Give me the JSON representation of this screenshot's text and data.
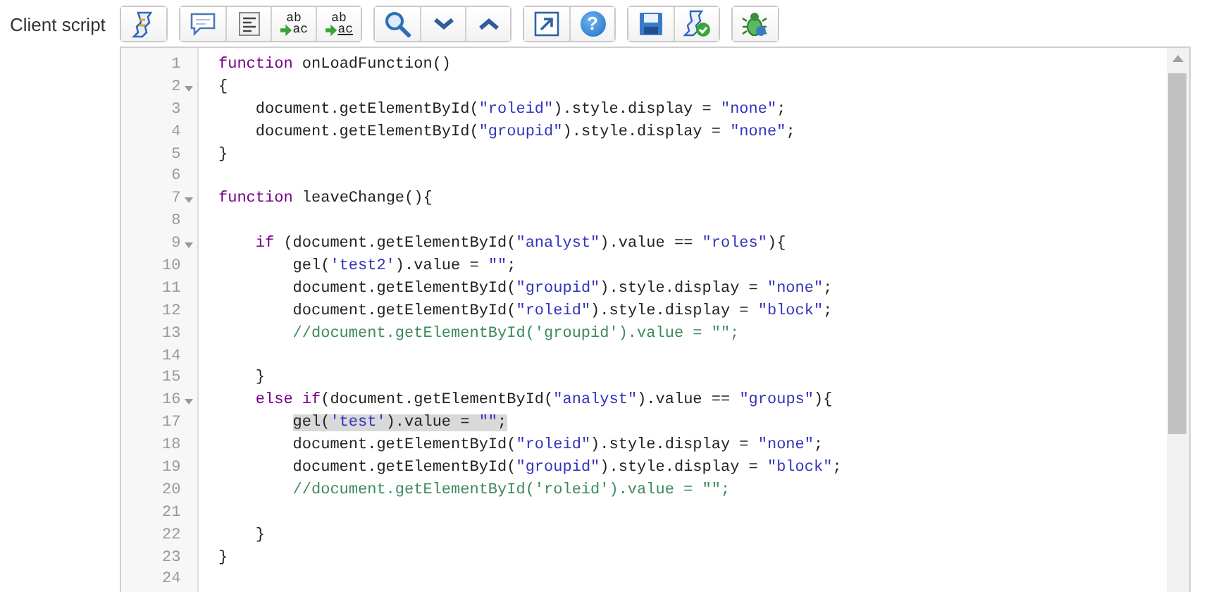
{
  "field_label": "Client script",
  "toolbar": [
    [
      {
        "kind": "script"
      }
    ],
    [
      {
        "kind": "comment"
      },
      {
        "kind": "format"
      },
      {
        "kind": "replace",
        "icon_text": [
          "ab",
          "ac"
        ]
      },
      {
        "kind": "replace_all",
        "icon_text": [
          "ab",
          "ac"
        ]
      }
    ],
    [
      {
        "kind": "search"
      },
      {
        "kind": "next"
      },
      {
        "kind": "previous"
      }
    ],
    [
      {
        "kind": "fullscreen"
      },
      {
        "kind": "help",
        "icon_text": [
          "?"
        ]
      }
    ],
    [
      {
        "kind": "save"
      },
      {
        "kind": "validate"
      }
    ],
    [
      {
        "kind": "debug"
      }
    ]
  ],
  "editor": {
    "lines": [
      {
        "number": "1",
        "fold": false,
        "selected": false,
        "kind": "flush",
        "tokens": [
          {
            "kind": "keyword",
            "text": "function"
          },
          {
            "kind": "plain",
            "text": " onLoadFunction()"
          }
        ]
      },
      {
        "number": "2",
        "fold": true,
        "selected": false,
        "kind": "flush",
        "tokens": [
          {
            "kind": "plain",
            "text": "{"
          }
        ]
      },
      {
        "number": "3",
        "fold": false,
        "selected": false,
        "kind": "indented",
        "tokens": [
          {
            "kind": "plain",
            "text": "document.getElementById("
          },
          {
            "kind": "string",
            "text": "\"roleid\""
          },
          {
            "kind": "plain",
            "text": ").style.display = "
          },
          {
            "kind": "string",
            "text": "\"none\""
          },
          {
            "kind": "plain",
            "text": ";"
          }
        ]
      },
      {
        "number": "4",
        "fold": false,
        "selected": false,
        "kind": "indented",
        "tokens": [
          {
            "kind": "plain",
            "text": "document.getElementById("
          },
          {
            "kind": "string",
            "text": "\"groupid\""
          },
          {
            "kind": "plain",
            "text": ").style.display = "
          },
          {
            "kind": "string",
            "text": "\"none\""
          },
          {
            "kind": "plain",
            "text": ";"
          }
        ]
      },
      {
        "number": "5",
        "fold": false,
        "selected": false,
        "kind": "flush",
        "tokens": [
          {
            "kind": "plain",
            "text": "}"
          }
        ]
      },
      {
        "number": "6",
        "fold": false,
        "selected": false,
        "kind": "flush"
      },
      {
        "number": "7",
        "fold": true,
        "selected": false,
        "kind": "flush",
        "tokens": [
          {
            "kind": "keyword",
            "text": "function"
          },
          {
            "kind": "plain",
            "text": " leaveChange(){"
          }
        ]
      },
      {
        "number": "8",
        "fold": false,
        "selected": false,
        "kind": "flush"
      },
      {
        "number": "9",
        "fold": true,
        "selected": false,
        "kind": "indented",
        "tokens": [
          {
            "kind": "keyword",
            "text": "if"
          },
          {
            "kind": "plain",
            "text": " (document.getElementById("
          },
          {
            "kind": "string",
            "text": "\"analyst\""
          },
          {
            "kind": "plain",
            "text": ").value == "
          },
          {
            "kind": "string",
            "text": "\"roles\""
          },
          {
            "kind": "plain",
            "text": "){"
          }
        ]
      },
      {
        "number": "10",
        "fold": false,
        "selected": false,
        "kind": "double_indented",
        "tokens": [
          {
            "kind": "plain",
            "text": "gel("
          },
          {
            "kind": "string",
            "text": "'test2'"
          },
          {
            "kind": "plain",
            "text": ").value = "
          },
          {
            "kind": "string",
            "text": "\"\""
          },
          {
            "kind": "plain",
            "text": ";"
          }
        ]
      },
      {
        "number": "11",
        "fold": false,
        "selected": false,
        "kind": "double_indented",
        "tokens": [
          {
            "kind": "plain",
            "text": "document.getElementById("
          },
          {
            "kind": "string",
            "text": "\"groupid\""
          },
          {
            "kind": "plain",
            "text": ").style.display = "
          },
          {
            "kind": "string",
            "text": "\"none\""
          },
          {
            "kind": "plain",
            "text": ";"
          }
        ]
      },
      {
        "number": "12",
        "fold": false,
        "selected": false,
        "kind": "double_indented",
        "tokens": [
          {
            "kind": "plain",
            "text": "document.getElementById("
          },
          {
            "kind": "string",
            "text": "\"roleid\""
          },
          {
            "kind": "plain",
            "text": ").style.display = "
          },
          {
            "kind": "string",
            "text": "\"block\""
          },
          {
            "kind": "plain",
            "text": ";"
          }
        ]
      },
      {
        "number": "13",
        "fold": false,
        "selected": false,
        "kind": "double_indented",
        "tokens": [
          {
            "kind": "comment",
            "text": "//document.getElementById('groupid').value = \"\";"
          }
        ]
      },
      {
        "number": "14",
        "fold": false,
        "selected": false,
        "kind": "flush"
      },
      {
        "number": "15",
        "fold": false,
        "selected": false,
        "kind": "indented",
        "tokens": [
          {
            "kind": "plain",
            "text": "}"
          }
        ]
      },
      {
        "number": "16",
        "fold": true,
        "selected": false,
        "kind": "indented",
        "tokens": [
          {
            "kind": "keyword",
            "text": "else if"
          },
          {
            "kind": "plain",
            "text": "(document.getElementById("
          },
          {
            "kind": "string",
            "text": "\"analyst\""
          },
          {
            "kind": "plain",
            "text": ").value == "
          },
          {
            "kind": "string",
            "text": "\"groups\""
          },
          {
            "kind": "plain",
            "text": "){"
          }
        ]
      },
      {
        "number": "17",
        "fold": false,
        "selected": true,
        "kind": "double_indented",
        "tokens": [
          {
            "kind": "plain",
            "text": "gel("
          },
          {
            "kind": "string",
            "text": "'test'"
          },
          {
            "kind": "plain",
            "text": ").value = "
          },
          {
            "kind": "string",
            "text": "\"\""
          },
          {
            "kind": "plain",
            "text": ";"
          }
        ]
      },
      {
        "number": "18",
        "fold": false,
        "selected": false,
        "kind": "double_indented",
        "tokens": [
          {
            "kind": "plain",
            "text": "document.getElementById("
          },
          {
            "kind": "string",
            "text": "\"roleid\""
          },
          {
            "kind": "plain",
            "text": ").style.display = "
          },
          {
            "kind": "string",
            "text": "\"none\""
          },
          {
            "kind": "plain",
            "text": ";"
          }
        ]
      },
      {
        "number": "19",
        "fold": false,
        "selected": false,
        "kind": "double_indented",
        "tokens": [
          {
            "kind": "plain",
            "text": "document.getElementById("
          },
          {
            "kind": "string",
            "text": "\"groupid\""
          },
          {
            "kind": "plain",
            "text": ").style.display = "
          },
          {
            "kind": "string",
            "text": "\"block\""
          },
          {
            "kind": "plain",
            "text": ";"
          }
        ]
      },
      {
        "number": "20",
        "fold": false,
        "selected": false,
        "kind": "double_indented",
        "tokens": [
          {
            "kind": "comment",
            "text": "//document.getElementById('roleid').value = \"\";"
          }
        ]
      },
      {
        "number": "21",
        "fold": false,
        "selected": false,
        "kind": "flush"
      },
      {
        "number": "22",
        "fold": false,
        "selected": false,
        "kind": "indented",
        "tokens": [
          {
            "kind": "plain",
            "text": "}"
          }
        ]
      },
      {
        "number": "23",
        "fold": false,
        "selected": false,
        "kind": "flush",
        "tokens": [
          {
            "kind": "plain",
            "text": "}"
          }
        ]
      },
      {
        "number": "24",
        "fold": false,
        "selected": false,
        "kind": "flush"
      }
    ]
  }
}
